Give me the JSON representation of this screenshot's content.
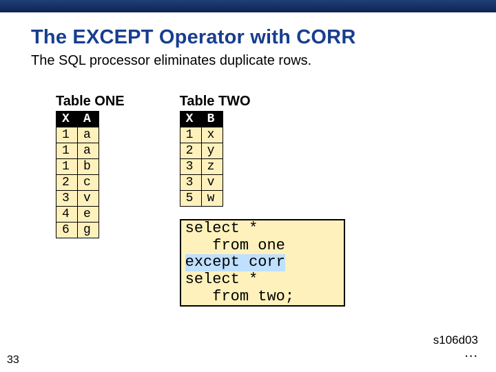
{
  "title": "The EXCEPT Operator with CORR",
  "subtitle": "The SQL processor eliminates duplicate rows.",
  "table_one": {
    "label": "Table ONE",
    "header": [
      "X",
      "A"
    ],
    "rows": [
      [
        "1",
        "a"
      ],
      [
        "1",
        "a"
      ],
      [
        "1",
        "b"
      ],
      [
        "2",
        "c"
      ],
      [
        "3",
        "v"
      ],
      [
        "4",
        "e"
      ],
      [
        "6",
        "g"
      ]
    ]
  },
  "table_two": {
    "label": "Table TWO",
    "header": [
      "X",
      "B"
    ],
    "rows": [
      [
        "1",
        "x"
      ],
      [
        "2",
        "y"
      ],
      [
        "3",
        "z"
      ],
      [
        "3",
        "v"
      ],
      [
        "5",
        "w"
      ]
    ]
  },
  "query": {
    "line1": "select *",
    "line2": "   from one",
    "line3a": "except",
    "line3b": " corr",
    "line4": "select *",
    "line5": "   from two;"
  },
  "slide_number": "33",
  "code_tag": "s106d03",
  "dots": "..."
}
